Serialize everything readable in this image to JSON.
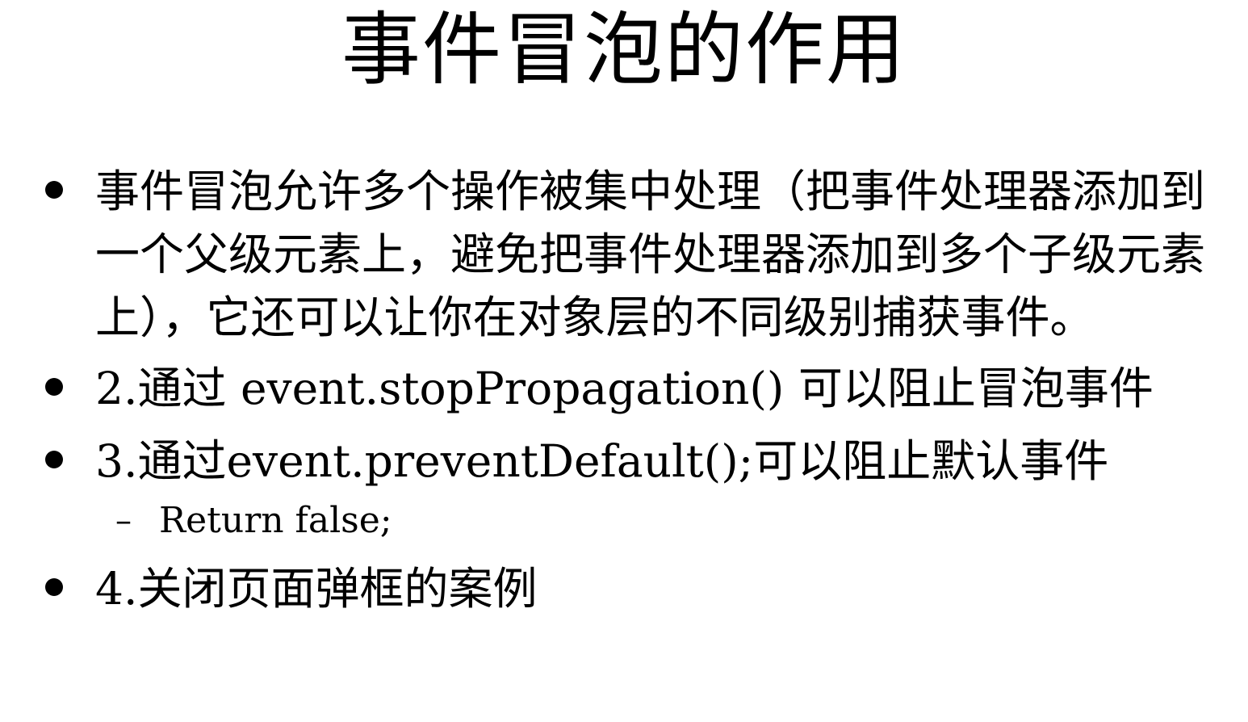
{
  "title": "事件冒泡的作用",
  "bullets": [
    {
      "text": "事件冒泡允许多个操作被集中处理（把事件处理器添加到一个父级元素上，避免把事件处理器添加到多个子级元素上），它还可以让你在对象层的不同级别捕获事件。"
    },
    {
      "text": "2.通过 event.stopPropagation() 可以阻止冒泡事件"
    },
    {
      "text": "3.通过event.preventDefault();可以阻止默认事件"
    },
    {
      "text": "4.关闭页面弹框的案例"
    }
  ],
  "sub_bullets": [
    {
      "dash": "–",
      "text": "Return false;"
    }
  ]
}
